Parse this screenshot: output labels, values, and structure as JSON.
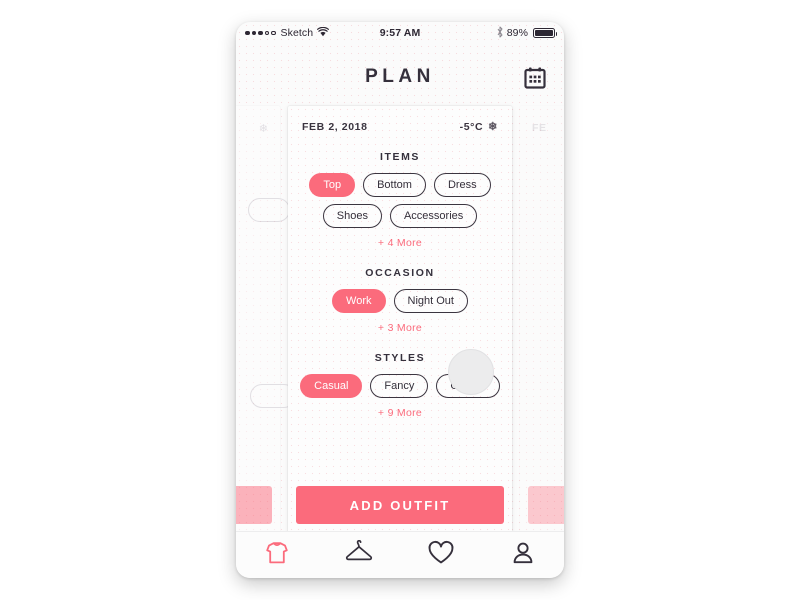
{
  "statusbar": {
    "carrier": "Sketch",
    "signal_filled": 3,
    "signal_empty": 2,
    "time": "9:57 AM",
    "battery_percent": "89%",
    "wifi_icon": "wifi-icon",
    "bluetooth_icon": "bluetooth-icon",
    "battery_icon": "battery-icon"
  },
  "header": {
    "title": "PLAN",
    "calendar_icon": "calendar-icon"
  },
  "colors": {
    "accent": "#fb6b7c",
    "text": "#35303c",
    "card": "#fdfdfd",
    "frame": "#fbfbfb"
  },
  "card": {
    "date": "FEB 2, 2018",
    "temperature": "-5°C",
    "weather_icon": "snowflake-icon",
    "sections": [
      {
        "title": "ITEMS",
        "chips": [
          {
            "label": "Top",
            "selected": true
          },
          {
            "label": "Bottom",
            "selected": false
          },
          {
            "label": "Dress",
            "selected": false
          },
          {
            "label": "Shoes",
            "selected": false
          },
          {
            "label": "Accessories",
            "selected": false
          }
        ],
        "more": "+ 4 More"
      },
      {
        "title": "OCCASION",
        "chips": [
          {
            "label": "Work",
            "selected": true
          },
          {
            "label": "Night Out",
            "selected": false
          }
        ],
        "more": "+ 3 More"
      },
      {
        "title": "STYLES",
        "chips": [
          {
            "label": "Casual",
            "selected": true
          },
          {
            "label": "Fancy",
            "selected": false
          },
          {
            "label": "Classic",
            "selected": false
          }
        ],
        "more": "+ 9 More"
      }
    ],
    "primary_action": "ADD OUTFIT"
  },
  "side_cards": {
    "right_partial_date": "FE"
  },
  "tabbar": {
    "items": [
      {
        "icon": "tshirt-icon",
        "active": true
      },
      {
        "icon": "hanger-icon",
        "active": false
      },
      {
        "icon": "heart-icon",
        "active": false
      },
      {
        "icon": "person-icon",
        "active": false
      }
    ]
  }
}
